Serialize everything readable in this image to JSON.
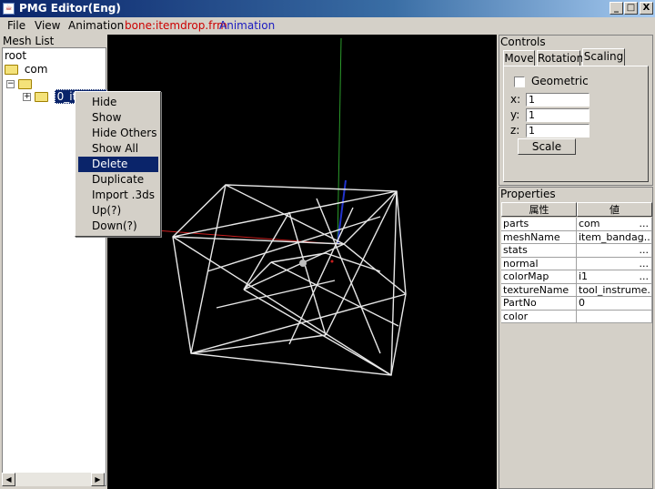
{
  "window": {
    "title": "PMG Editor(Eng)",
    "buttons": {
      "minimize": "_",
      "maximize": "□",
      "close": "X"
    }
  },
  "menu": {
    "file": "File",
    "view": "View",
    "animation": "Animation",
    "bone_file": "bone:itemdrop.frm",
    "animation_status": "Animation",
    "bone_color": "#cc0000",
    "animation_color": "#1a1ac0"
  },
  "mesh_list": {
    "title": "Mesh List",
    "root": "root",
    "com": "com",
    "item": "0_item..."
  },
  "context_menu": {
    "items": [
      "Hide",
      "Show",
      "Hide Others",
      "Show All",
      "Delete",
      "Duplicate",
      "Import .3ds",
      "Up(?)",
      "Down(?)"
    ],
    "active_index": 4
  },
  "controls": {
    "title": "Controls",
    "tabs": [
      "Move",
      "Rotation",
      "Scaling"
    ],
    "active_tab": "Scaling",
    "geometric_label": "Geometric",
    "x_label": "x:",
    "y_label": "y:",
    "z_label": "z:",
    "x_value": "1",
    "y_value": "1",
    "z_value": "1",
    "scale_button": "Scale"
  },
  "properties": {
    "title": "Properties",
    "headers": [
      "属性",
      "値"
    ],
    "rows": [
      {
        "name": "parts",
        "value": "com",
        "dots": "..."
      },
      {
        "name": "meshName",
        "value": "item_bandag...",
        "dots": ""
      },
      {
        "name": "stats",
        "value": "",
        "dots": "..."
      },
      {
        "name": "normal",
        "value": "",
        "dots": "..."
      },
      {
        "name": "colorMap",
        "value": "i1",
        "dots": "..."
      },
      {
        "name": "textureName",
        "value": "tool_instrume...",
        "dots": ""
      },
      {
        "name": "PartNo",
        "value": "0",
        "dots": ""
      },
      {
        "name": "color",
        "value": "",
        "dots": ""
      }
    ]
  }
}
